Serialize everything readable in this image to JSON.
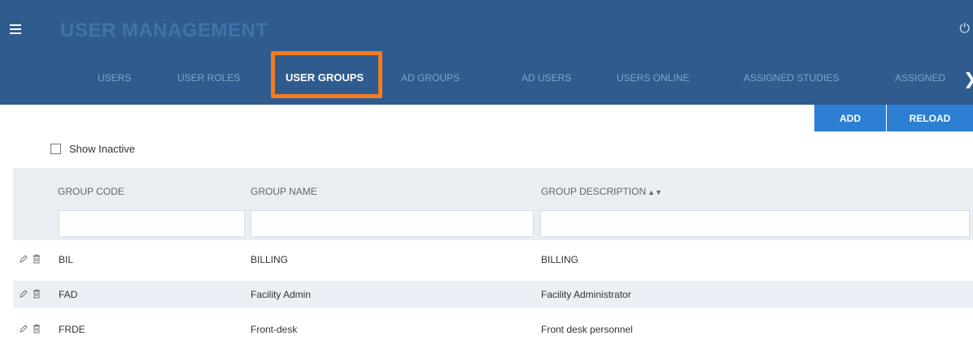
{
  "header": {
    "title": "USER MANAGEMENT",
    "menu_icon": "hamburger-icon",
    "power_icon": "power-icon"
  },
  "tabs": [
    {
      "label": "USERS",
      "active": false
    },
    {
      "label": "USER ROLES",
      "active": false
    },
    {
      "label": "USER GROUPS",
      "active": true
    },
    {
      "label": "AD GROUPS",
      "active": false
    },
    {
      "label": "AD USERS",
      "active": false
    },
    {
      "label": "USERS ONLINE",
      "active": false
    },
    {
      "label": "ASSIGNED STUDIES",
      "active": false
    },
    {
      "label": "ASSIGNED",
      "active": false
    }
  ],
  "toolbar": {
    "add_label": "ADD",
    "reload_label": "RELOAD"
  },
  "filters": {
    "show_inactive_label": "Show Inactive",
    "show_inactive_checked": false
  },
  "table": {
    "columns": [
      "GROUP CODE",
      "GROUP NAME",
      "GROUP DESCRIPTION"
    ],
    "sorted_column": "GROUP DESCRIPTION",
    "rows": [
      {
        "code": "BIL",
        "name": "BILLING",
        "description": "BILLING"
      },
      {
        "code": "FAD",
        "name": "Facility Admin",
        "description": "Facility Administrator"
      },
      {
        "code": "FRDE",
        "name": "Front-desk",
        "description": "Front desk personnel"
      }
    ]
  },
  "colors": {
    "header_bg": "#2f5b8e",
    "button_bg": "#2d7fd3",
    "highlight": "#f57c20",
    "row_alt": "#eaf0f5"
  }
}
